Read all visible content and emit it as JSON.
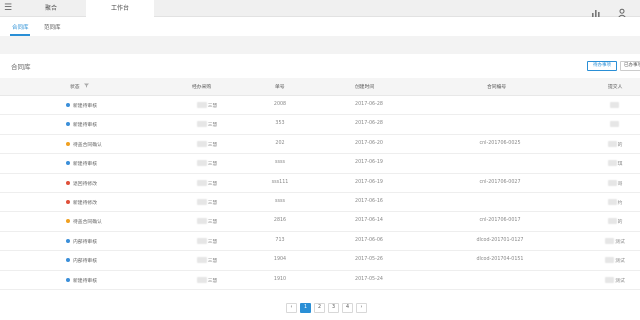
{
  "topbar": {
    "menu_icon": "menu-icon",
    "tabs": [
      {
        "label": "聚合"
      },
      {
        "label": "工作台"
      }
    ],
    "right_icons": [
      "bar-chart-icon",
      "user-icon"
    ]
  },
  "subtabs": [
    {
      "label": "合同库",
      "active": true
    },
    {
      "label": "范同库",
      "active": false
    }
  ],
  "panel": {
    "title": "合同库",
    "btn_pending": "待办事项",
    "btn_done": "已办事项"
  },
  "table": {
    "headers": {
      "status": "状态",
      "filter_icon": "filter-icon",
      "applicant": "经办采购",
      "number": "单号",
      "date": "创建时间",
      "contract": "合同编号",
      "submitter": "提交人"
    },
    "status_colors": {
      "blue": "#3b8fd9",
      "orange": "#f0a020",
      "red": "#e0503a"
    },
    "rows": [
      {
        "status": "新建待审核",
        "dot": "blue",
        "applicant": "三慧",
        "number": "2008",
        "date": "2017-06-28",
        "contract": "",
        "submitter": ""
      },
      {
        "status": "新建待审核",
        "dot": "blue",
        "applicant": "三慧",
        "number": "353",
        "date": "2017-06-28",
        "contract": "",
        "submitter": ""
      },
      {
        "status": "待盖合同确认",
        "dot": "orange",
        "applicant": "三慧",
        "number": "202",
        "date": "2017-06-20",
        "contract": "cnl-201706-0025",
        "submitter": "的"
      },
      {
        "status": "新建待审核",
        "dot": "blue",
        "applicant": "三慧",
        "number": "ssss",
        "date": "2017-06-19",
        "contract": "",
        "submitter": "琪"
      },
      {
        "status": "退回待修改",
        "dot": "red",
        "applicant": "三慧",
        "number": "sss111",
        "date": "2017-06-19",
        "contract": "cnl-201706-0027",
        "submitter": "哥"
      },
      {
        "status": "新建待修改",
        "dot": "red",
        "applicant": "三慧",
        "number": "ssss",
        "date": "2017-06-16",
        "contract": "",
        "submitter": "约"
      },
      {
        "status": "待盖合同确认",
        "dot": "orange",
        "applicant": "三慧",
        "number": "2816",
        "date": "2017-06-14",
        "contract": "cnl-201706-0017",
        "submitter": "的"
      },
      {
        "status": "内部待审核",
        "dot": "blue",
        "applicant": "三慧",
        "number": "713",
        "date": "2017-06-06",
        "contract": "dlcod-201701-0127",
        "submitter": "测试"
      },
      {
        "status": "内部待审核",
        "dot": "blue",
        "applicant": "三慧",
        "number": "1904",
        "date": "2017-05-26",
        "contract": "dlcod-201704-0151",
        "submitter": "测试"
      },
      {
        "status": "新建待审核",
        "dot": "blue",
        "applicant": "三慧",
        "number": "1910",
        "date": "2017-05-24",
        "contract": "",
        "submitter": "测试"
      }
    ]
  },
  "pagination": {
    "prev": "‹",
    "pages": [
      "1",
      "2",
      "3",
      "4"
    ],
    "next": "›",
    "current": "1"
  }
}
